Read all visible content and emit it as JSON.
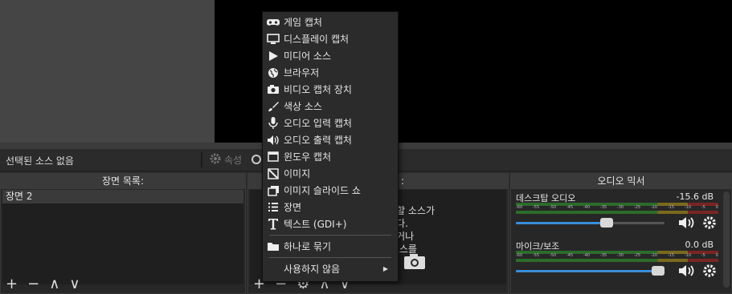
{
  "toolbar": {
    "no_source": "선택된 소스 없음",
    "properties_label": "속성"
  },
  "scenes": {
    "title": "장면 목록:",
    "items": [
      "장면 2"
    ]
  },
  "sources": {
    "title_fragment": ":",
    "empty_text_lines": [
      "추가할 소스가",
      "습니다.",
      "눌러거나",
      "서 소스를",
      "으."
    ]
  },
  "mixer": {
    "title": "오디오 믹서",
    "channels": [
      {
        "name": "데스크탑 오디오",
        "db": "-15.6 dB",
        "volume": 0.62
      },
      {
        "name": "마이크/보조",
        "db": "0.0 dB",
        "volume": 1.0
      }
    ],
    "ticks": [
      "-60",
      "-55",
      "-50",
      "-45",
      "-40",
      "-35",
      "-30",
      "-25",
      "-20",
      "-15",
      "-10",
      "-5",
      "0"
    ]
  },
  "menu": {
    "items": [
      {
        "label": "게임 캡처",
        "icon": "gamepad-icon"
      },
      {
        "label": "디스플레이 캡처",
        "icon": "monitor-icon"
      },
      {
        "label": "미디어 소스",
        "icon": "play-icon"
      },
      {
        "label": "브라우저",
        "icon": "globe-icon"
      },
      {
        "label": "비디오 캡처 장치",
        "icon": "camera-icon"
      },
      {
        "label": "색상 소스",
        "icon": "brush-icon"
      },
      {
        "label": "오디오 입력 캡처",
        "icon": "microphone-icon"
      },
      {
        "label": "오디오 출력 캡처",
        "icon": "speaker-icon"
      },
      {
        "label": "윈도우 캡처",
        "icon": "window-icon"
      },
      {
        "label": "이미지",
        "icon": "image-icon"
      },
      {
        "label": "이미지 슬라이드 쇼",
        "icon": "slideshow-icon"
      },
      {
        "label": "장면",
        "icon": "list-icon"
      },
      {
        "label": "텍스트 (GDI+)",
        "icon": "text-icon"
      },
      {
        "label": "하나로 묶기",
        "icon": "folder-icon"
      },
      {
        "label": "사용하지 않음",
        "icon": ""
      }
    ]
  }
}
